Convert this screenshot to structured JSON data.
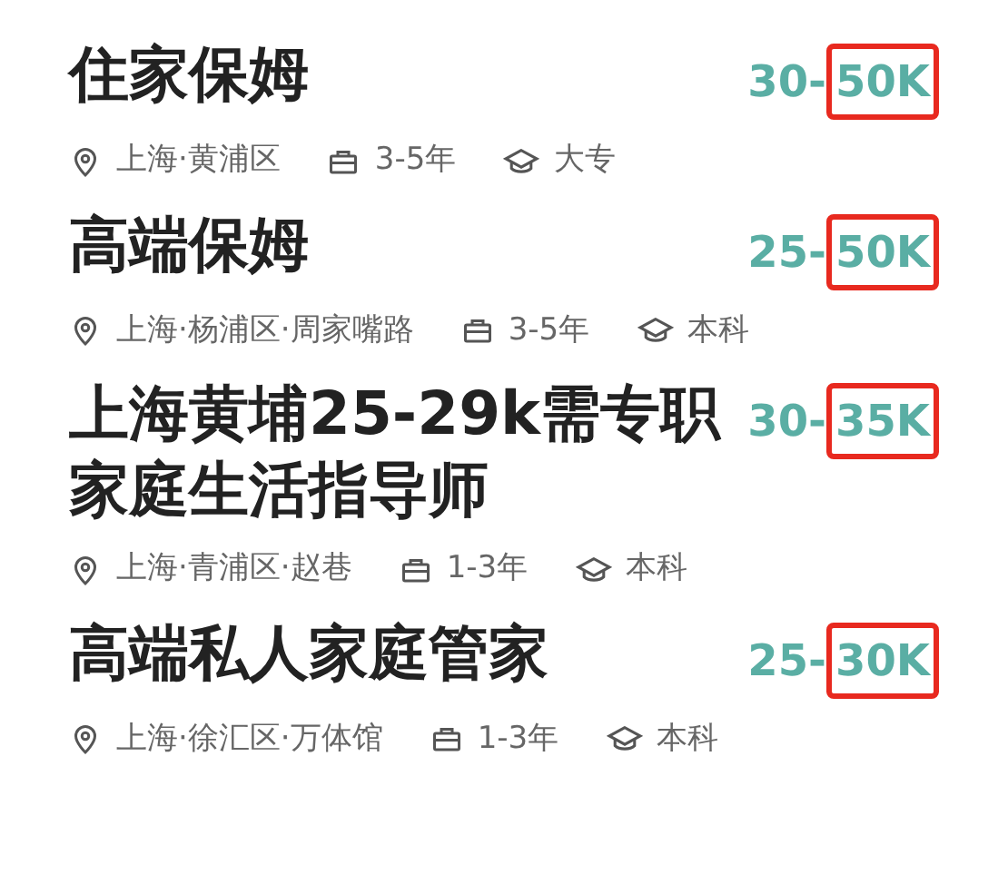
{
  "jobs": [
    {
      "title": "住家保姆",
      "salary_low": "30-",
      "salary_high": "50K",
      "high_marked": true,
      "location": "上海·黄浦区",
      "experience": "3-5年",
      "education": "大专"
    },
    {
      "title": "高端保姆",
      "salary_low": "25-",
      "salary_high": "50K",
      "high_marked": true,
      "location": "上海·杨浦区·周家嘴路",
      "experience": "3-5年",
      "education": "本科"
    },
    {
      "title": "上海黄埔25-29k需专职家庭生活指导师",
      "salary_low": "30-",
      "salary_high": "35K",
      "high_marked": true,
      "location": "上海·青浦区·赵巷",
      "experience": "1-3年",
      "education": "本科"
    },
    {
      "title": "高端私人家庭管家",
      "salary_low": "25-",
      "salary_high": "30K",
      "high_marked": true,
      "location": "上海·徐汇区·万体馆",
      "experience": "1-3年",
      "education": "本科"
    }
  ]
}
